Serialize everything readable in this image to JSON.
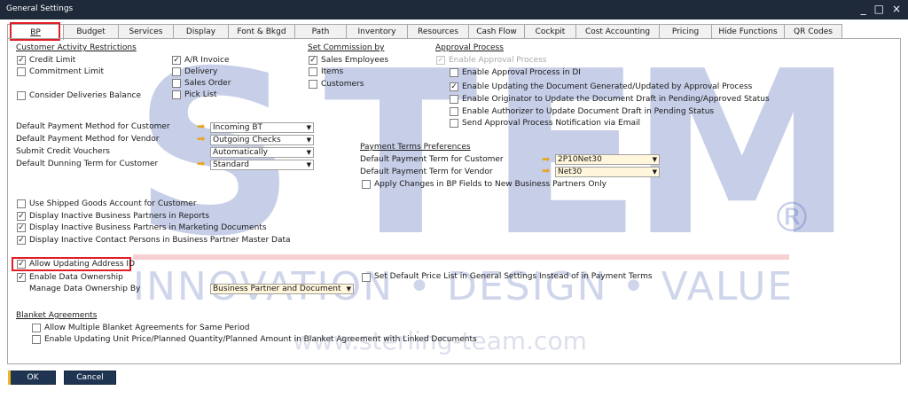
{
  "window": {
    "title": "General Settings",
    "minimize": "_",
    "maximize": "□",
    "close": "×"
  },
  "tabs": [
    "BP",
    "Budget",
    "Services",
    "Display",
    "Font & Bkgd",
    "Path",
    "Inventory",
    "Resources",
    "Cash Flow",
    "Cockpit",
    "Cost Accounting",
    "Pricing",
    "Hide Functions",
    "QR Codes"
  ],
  "watermark": {
    "brand": "STEM",
    "registered": "®",
    "tagline": "INNOVATION • DESIGN • VALUE",
    "url": "www.sterling-team.com"
  },
  "customer_activity": {
    "title": "Customer Activity Restrictions",
    "credit_limit": "Credit Limit",
    "commitment_limit": "Commitment Limit",
    "consider_deliveries": "Consider Deliveries Balance",
    "ar_invoice": "A/R Invoice",
    "delivery": "Delivery",
    "sales_order": "Sales Order",
    "pick_list": "Pick List"
  },
  "commission": {
    "title": "Set Commission by",
    "sales_employees": "Sales Employees",
    "items": "Items",
    "customers": "Customers"
  },
  "approval": {
    "title": "Approval Process",
    "enable": "Enable Approval Process",
    "enable_di": "Enable Approval Process in DI",
    "enable_updating": "Enable Updating the Document Generated/Updated by Approval Process",
    "enable_originator": "Enable Originator to Update the Document Draft in Pending/Approved Status",
    "enable_authorizer": "Enable Authorizer to Update Document Draft in Pending Status",
    "send_notification": "Send Approval Process Notification via Email"
  },
  "payment": {
    "customer_method_label": "Default Payment Method for Customer",
    "customer_method_value": "Incoming BT",
    "vendor_method_label": "Default Payment Method for Vendor",
    "vendor_method_value": "Outgoing Checks",
    "credit_vouchers_label": "Submit Credit Vouchers",
    "credit_vouchers_value": "Automatically",
    "dunning_label": "Default Dunning Term for Customer",
    "dunning_value": "Standard"
  },
  "payment_terms": {
    "title": "Payment Terms Preferences",
    "customer_label": "Default Payment Term for Customer",
    "customer_value": "2P10Net30",
    "vendor_label": "Default Payment Term for Vendor",
    "vendor_value": "Net30",
    "apply_changes": "Apply Changes in BP Fields to New Business Partners Only"
  },
  "options": {
    "use_shipped_goods": "Use Shipped Goods Account for Customer",
    "inactive_reports": "Display Inactive Business Partners in Reports",
    "inactive_marketing": "Display Inactive Business Partners in Marketing Documents",
    "inactive_contacts": "Display Inactive Contact Persons in Business Partner Master Data",
    "allow_address_id": "Allow Updating Address ID",
    "enable_ownership": "Enable Data Ownership",
    "manage_ownership_label": "Manage Data Ownership By",
    "manage_ownership_value": "Business Partner and Document",
    "default_price_list": "Set Default Price List in General Settings Instead of in Payment Terms"
  },
  "blanket": {
    "title": "Blanket Agreements",
    "allow_multiple": "Allow Multiple Blanket Agreements for Same Period",
    "enable_updating": "Enable Updating Unit Price/Planned Quantity/Planned Amount in Blanket Agreement with Linked Documents"
  },
  "buttons": {
    "ok": "OK",
    "cancel": "Cancel"
  },
  "colors": {
    "highlight": "#e21d26",
    "link_arrow": "#e8a318",
    "button": "#1f3552",
    "title_bar": "#1e2a3a"
  }
}
